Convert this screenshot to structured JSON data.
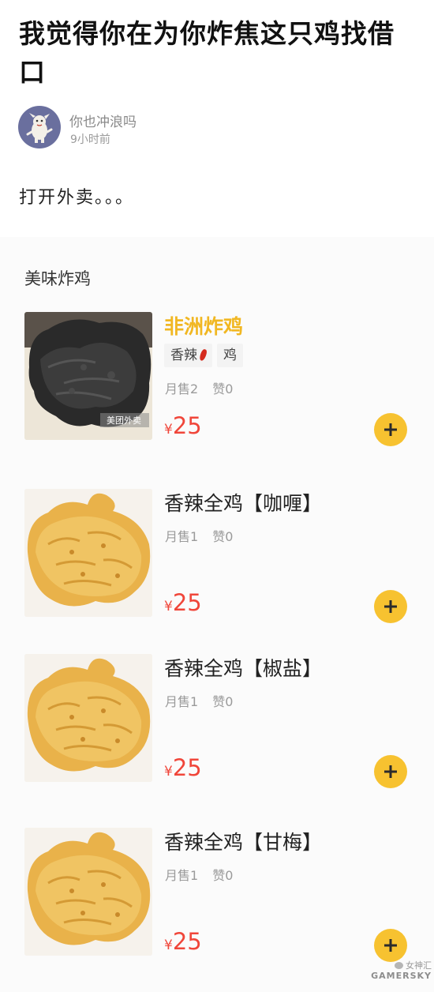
{
  "post": {
    "title": "我觉得你在为你炸焦这只鸡找借口",
    "author": "你也冲浪吗",
    "time": "9小时前",
    "body": "打开外卖。。。"
  },
  "menu": {
    "section_title": "美味炸鸡",
    "items": [
      {
        "name": "非洲炸鸡",
        "tags": [
          "香辣",
          "鸡"
        ],
        "sold": "月售2",
        "likes": "赞0",
        "currency": "¥",
        "price": "25",
        "photo": "burnt-fried-chicken",
        "photo_caption": "美团外卖"
      },
      {
        "name": "香辣全鸡【咖喱】",
        "sold": "月售1",
        "likes": "赞0",
        "currency": "¥",
        "price": "25",
        "photo": "golden-fried-chicken"
      },
      {
        "name": "香辣全鸡【椒盐】",
        "sold": "月售1",
        "likes": "赞0",
        "currency": "¥",
        "price": "25",
        "photo": "golden-fried-chicken"
      },
      {
        "name": "香辣全鸡【甘梅】",
        "sold": "月售1",
        "likes": "赞0",
        "currency": "¥",
        "price": "25",
        "photo": "golden-fried-chicken"
      }
    ]
  },
  "colors": {
    "highlight_name": "#f1b722",
    "price": "#f0463a",
    "add_button": "#f7c230",
    "avatar_bg": "#6a6f9e"
  },
  "watermark": {
    "line1": "女神汇",
    "line2": "GAMERSKY"
  }
}
